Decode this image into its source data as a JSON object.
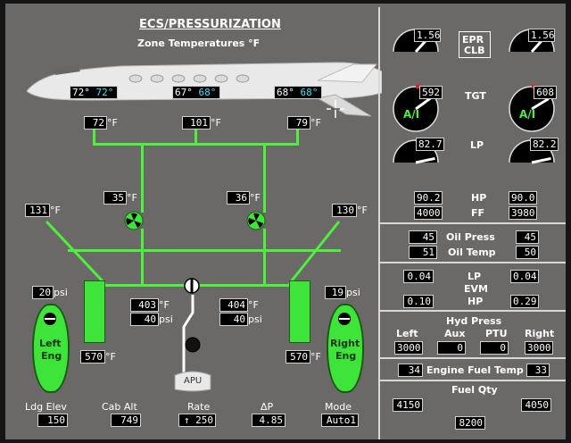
{
  "title": "ECS/PRESSURIZATION",
  "subtitle": "Zone Temperatures °F",
  "zones": [
    {
      "actual": "72°",
      "target": "72°"
    },
    {
      "actual": "67°",
      "target": "68°"
    },
    {
      "actual": "68°",
      "target": "68°"
    }
  ],
  "duct_temps": [
    "72",
    "101",
    "79"
  ],
  "pack_temps": [
    "35",
    "36"
  ],
  "bleed_temps": [
    "131",
    "130"
  ],
  "left_bleed": {
    "psi": "20",
    "temp": "570"
  },
  "right_bleed": {
    "psi": "19",
    "temp": "570"
  },
  "center": {
    "left_temp": "403",
    "left_psi": "40",
    "right_temp": "404",
    "right_psi": "40"
  },
  "units": {
    "degF": "°F",
    "psi": "psi"
  },
  "apu_label": "APU",
  "left_eng": [
    "Left",
    "Eng"
  ],
  "right_eng": [
    "Right",
    "Eng"
  ],
  "bottom": [
    {
      "label": "Ldg Elev",
      "value": "150"
    },
    {
      "label": "Cab Alt",
      "value": "749"
    },
    {
      "label": "Rate",
      "value": "↑ 250"
    },
    {
      "label": "ΔP",
      "value": "4.85"
    },
    {
      "label": "Mode",
      "value": "Auto1"
    }
  ],
  "epr": {
    "label1": "EPR",
    "label2": "CLB",
    "left": "1.56",
    "right": "1.56",
    "left_level": 0.55,
    "right_level": 0.55
  },
  "tgt": {
    "label": "TGT",
    "left": "592",
    "right": "608",
    "left_ai": "A/I",
    "right_ai": "A/I",
    "left_level": 0.6,
    "right_level": 0.62
  },
  "lp": {
    "label": "LP",
    "left": "82.7",
    "right": "82.2",
    "left_level": 0.7,
    "right_level": 0.7
  },
  "hp": {
    "label": "HP",
    "left": "90.2",
    "right": "90.0"
  },
  "ff": {
    "label": "FF",
    "left": "4000",
    "right": "3980"
  },
  "oil_press": {
    "label": "Oil Press",
    "left": "45",
    "right": "45"
  },
  "oil_temp": {
    "label": "Oil Temp",
    "left": "51",
    "right": "50"
  },
  "evm": {
    "label": "EVM",
    "lp_label": "LP",
    "hp_label": "HP",
    "lp_left": "0.04",
    "lp_right": "0.04",
    "hp_left": "0.10",
    "hp_right": "0.29"
  },
  "hyd": {
    "title": "Hyd Press",
    "labels": [
      "Left",
      "Aux",
      "PTU",
      "Right"
    ],
    "values": [
      "3000",
      "0",
      "0",
      "3000"
    ]
  },
  "fuel_temp": {
    "label": "Engine Fuel Temp",
    "left": "34",
    "right": "33"
  },
  "fuel_qty": {
    "label": "Fuel Qty",
    "left": "4150",
    "right": "4050",
    "total": "8200"
  },
  "colors": {
    "duct_green": "#4df03c",
    "cyan": "#2ee6ff",
    "background": "#6b6868",
    "alert_red": "#e02020",
    "amber": "#e0b020"
  }
}
